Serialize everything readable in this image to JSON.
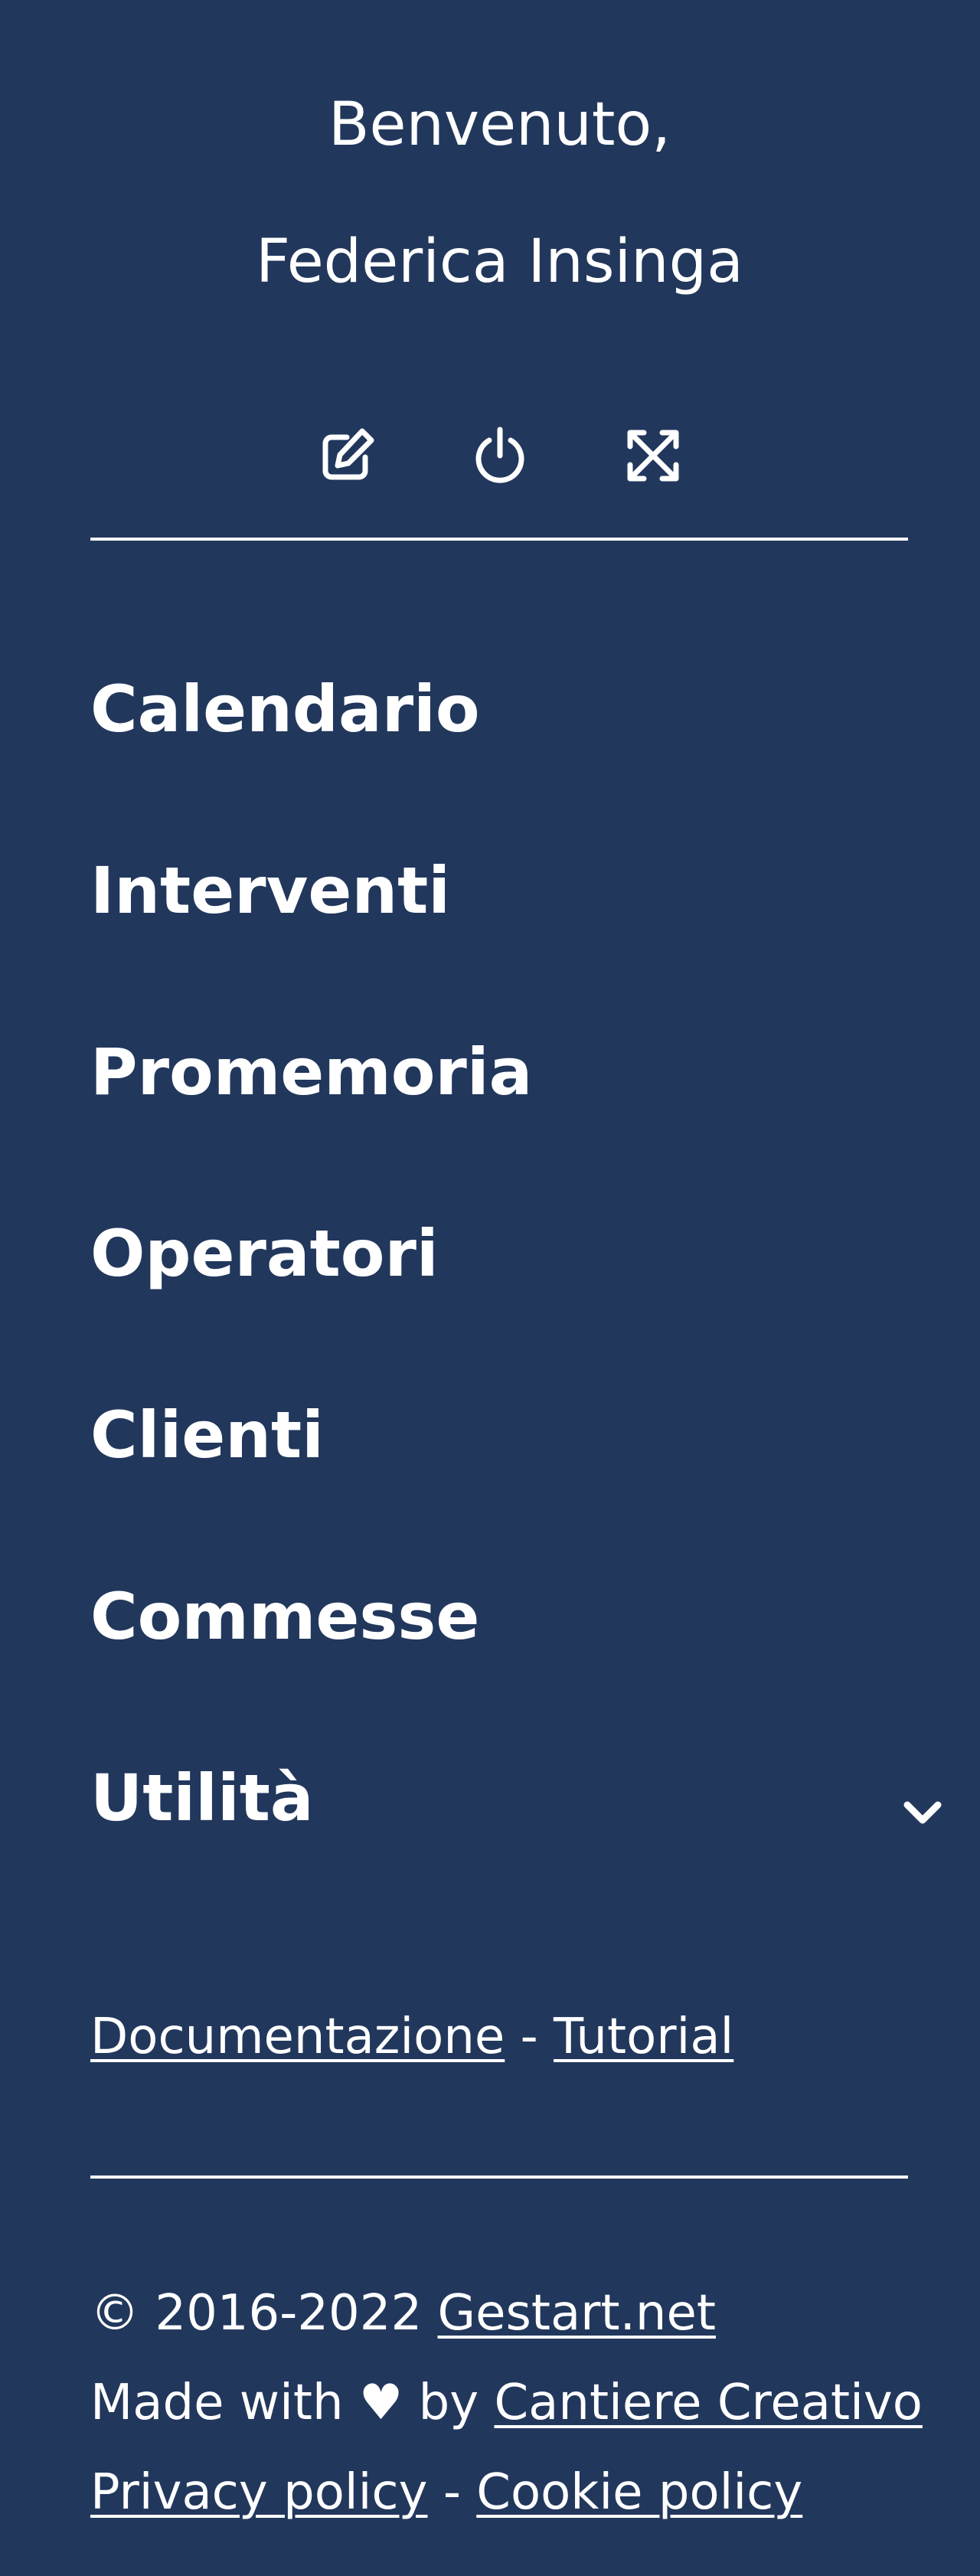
{
  "welcome": {
    "greeting": "Benvenuto,",
    "user_name": "Federica Insinga"
  },
  "toolbar": {
    "icons": [
      "edit-icon",
      "power-icon",
      "fullscreen-icon"
    ]
  },
  "menu": {
    "items": [
      {
        "label": "Calendario"
      },
      {
        "label": "Interventi"
      },
      {
        "label": "Promemoria"
      },
      {
        "label": "Operatori"
      },
      {
        "label": "Clienti"
      },
      {
        "label": "Commesse"
      },
      {
        "label": "Utilità",
        "icon": "chevron-down-icon"
      }
    ]
  },
  "links": {
    "documentation": "Documentazione",
    "separator": " - ",
    "tutorial": "Tutorial"
  },
  "footer": {
    "copyright": "© 2016-2022 ",
    "site_link": "Gestart.net",
    "made_with": "Made with ♥ by ",
    "agency_link": "Cantiere Creativo",
    "privacy_link": "Privacy policy",
    "separator": " - ",
    "cookie_link": "Cookie policy"
  },
  "colors": {
    "background": "#22375c",
    "text": "#ffffff"
  }
}
